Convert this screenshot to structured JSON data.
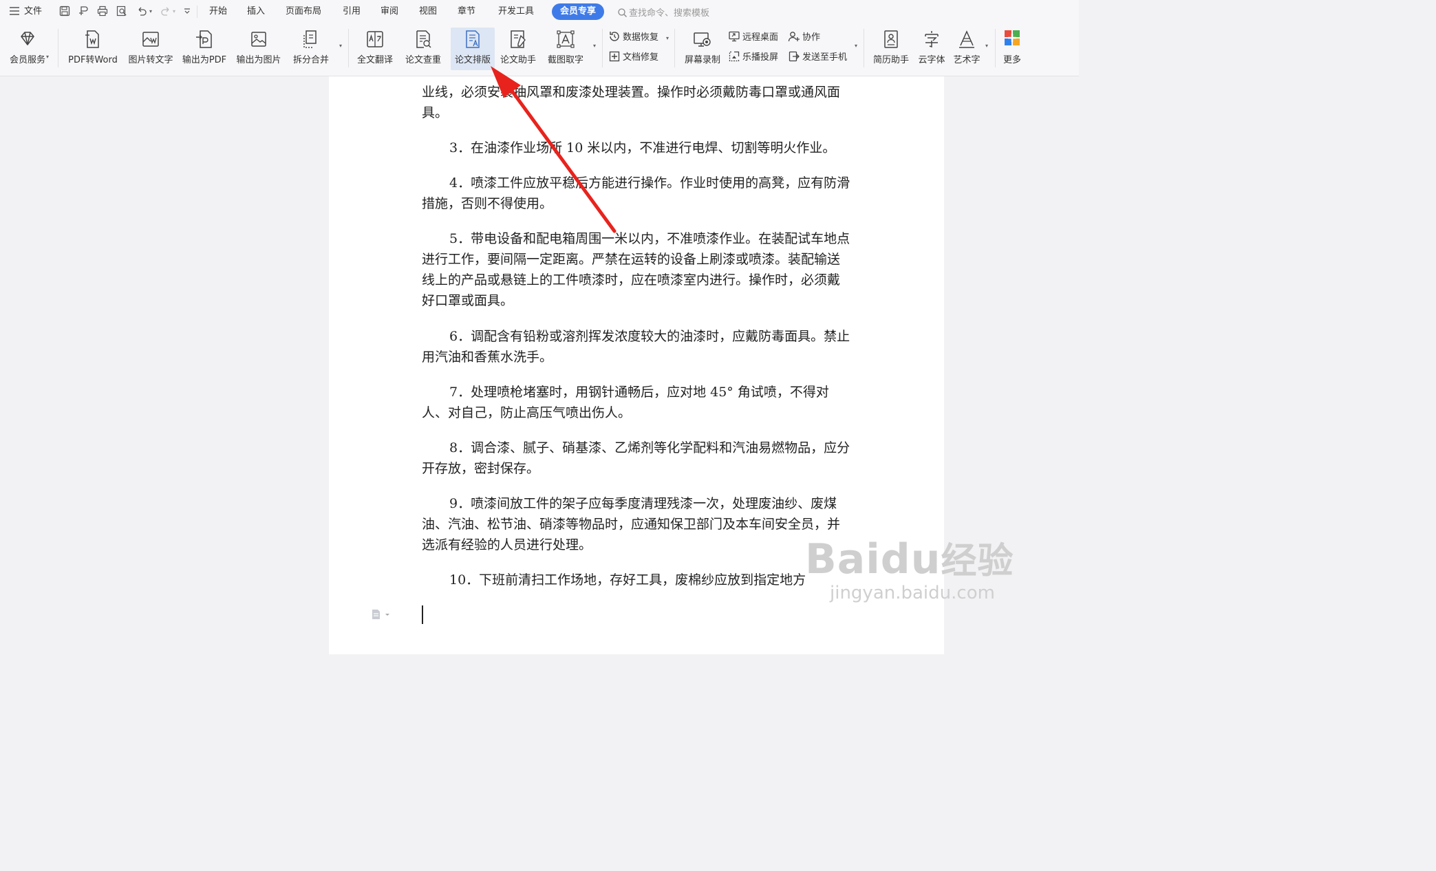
{
  "menubar": {
    "file": "文件",
    "tabs": [
      "开始",
      "插入",
      "页面布局",
      "引用",
      "审阅",
      "视图",
      "章节",
      "开发工具"
    ],
    "vip_tab": "会员专享",
    "search_placeholder": "查找命令、搜索模板"
  },
  "toolbar": {
    "member_service": "会员服务",
    "pdf_to_word": "PDF转Word",
    "image_to_text": "图片转文字",
    "export_pdf": "输出为PDF",
    "export_image": "输出为图片",
    "split_merge": "拆分合并",
    "translate": "全文翻译",
    "paper_check": "论文查重",
    "paper_format": "论文排版",
    "paper_assistant": "论文助手",
    "screenshot_ocr": "截图取字",
    "data_recovery": "数据恢复",
    "doc_repair": "文档修复",
    "screen_record": "屏幕录制",
    "remote_desktop": "远程桌面",
    "cast_screen": "乐播投屏",
    "collaborate": "协作",
    "send_to_phone": "发送至手机",
    "resume_helper": "简历助手",
    "cloud_font": "云字体",
    "word_art": "艺术字",
    "more": "更多"
  },
  "document": {
    "paragraphs": [
      "业线，必须安装抽风罩和废漆处理装置。操作时必须戴防毒口罩或通风面具。",
      "3．在油漆作业场所 10 米以内，不准进行电焊、切割等明火作业。",
      "4．喷漆工件应放平稳后方能进行操作。作业时使用的高凳，应有防滑措施，否则不得使用。",
      "5．带电设备和配电箱周围一米以内，不准喷漆作业。在装配试车地点进行工作，要间隔一定距离。严禁在运转的设备上刷漆或喷漆。装配输送线上的产品或悬链上的工件喷漆时，应在喷漆室内进行。操作时，必须戴好口罩或面具。",
      "6．调配含有铅粉或溶剂挥发浓度较大的油漆时，应戴防毒面具。禁止用汽油和香蕉水洗手。",
      "7．处理喷枪堵塞时，用钢针通畅后，应对地 45° 角试喷，不得对人、对自己，防止高压气喷出伤人。",
      "8．调合漆、腻子、硝基漆、乙烯剂等化学配料和汽油易燃物品，应分开存放，密封保存。",
      "9．喷漆间放工件的架子应每季度清理残漆一次，处理废油纱、废煤油、汽油、松节油、硝漆等物品时，应通知保卫部门及本车间安全员，并选派有经验的人员进行处理。",
      "10．下班前清扫工作场地，存好工具，废棉纱应放到指定地方"
    ]
  },
  "watermark": {
    "brand": "Baidu",
    "brand_cn": "经验",
    "url": "jingyan.baidu.com"
  },
  "colors": {
    "accent": "#3f7be8",
    "arrow": "#e8231d",
    "active_bg": "#dde6f4"
  }
}
